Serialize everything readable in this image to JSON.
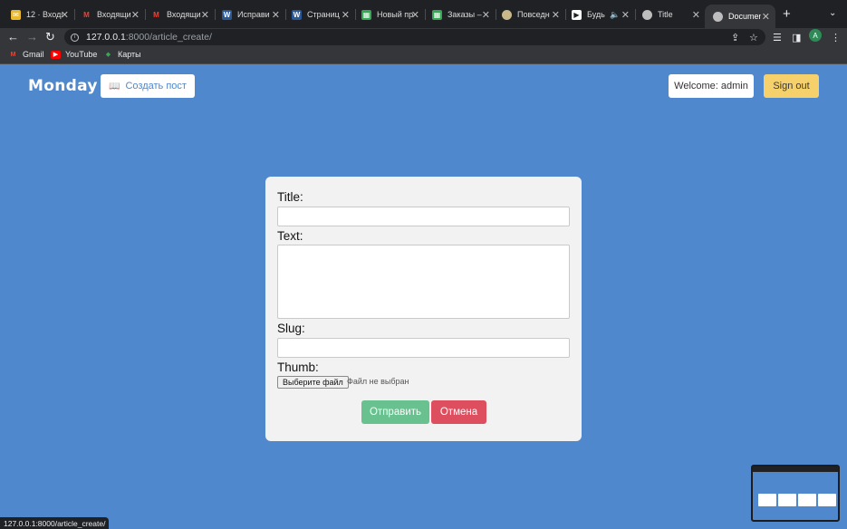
{
  "browser": {
    "tabs": [
      {
        "title": "12 · Входя",
        "icon": "gmail-envelope-icon",
        "color": "#e8b931"
      },
      {
        "title": "Входящи",
        "icon": "gmail-icon",
        "color": "#ea4335"
      },
      {
        "title": "Входящи",
        "icon": "gmail-icon",
        "color": "#ea4335"
      },
      {
        "title": "Исправи",
        "icon": "word-icon",
        "color": "#2b5797"
      },
      {
        "title": "Страниц",
        "icon": "word-icon",
        "color": "#2b5797"
      },
      {
        "title": "Новый пр",
        "icon": "sheets-icon",
        "color": "#34a853"
      },
      {
        "title": "Заказы –",
        "icon": "sheets-icon",
        "color": "#34a853"
      },
      {
        "title": "Повседн",
        "icon": "globe-icon",
        "color": "#c9b88a"
      },
      {
        "title": "Будь",
        "icon": "play-icon",
        "color": "#ffffff"
      },
      {
        "title": "Title",
        "icon": "globe-icon",
        "color": "#bdbdbd"
      },
      {
        "title": "Documen",
        "icon": "globe-icon",
        "color": "#bdbdbd"
      }
    ],
    "url_host": "127.0.0.1",
    "url_path": ":8000/article_create/",
    "profile_initial": "A",
    "bookmarks": [
      {
        "label": "Gmail",
        "icon": "gmail-icon"
      },
      {
        "label": "YouTube",
        "icon": "youtube-icon"
      },
      {
        "label": "Карты",
        "icon": "maps-icon"
      }
    ],
    "status_url": "127.0.0.1:8000/article_create/"
  },
  "header": {
    "logo": "Monday",
    "create_post": "Создать пост",
    "welcome": "Welcome: admin",
    "sign_out": "Sign out"
  },
  "form": {
    "title_label": "Title:",
    "text_label": "Text:",
    "slug_label": "Slug:",
    "thumb_label": "Thumb:",
    "file_button": "Выберите файл",
    "file_status": "Файл не выбран",
    "submit": "Отправить",
    "cancel": "Отмена"
  },
  "colors": {
    "page_bg": "#4f88cc",
    "card_bg": "#f2f2f2",
    "submit_bg": "#69c190",
    "cancel_bg": "#dd4f5f",
    "signout_bg": "#f5d06b"
  }
}
